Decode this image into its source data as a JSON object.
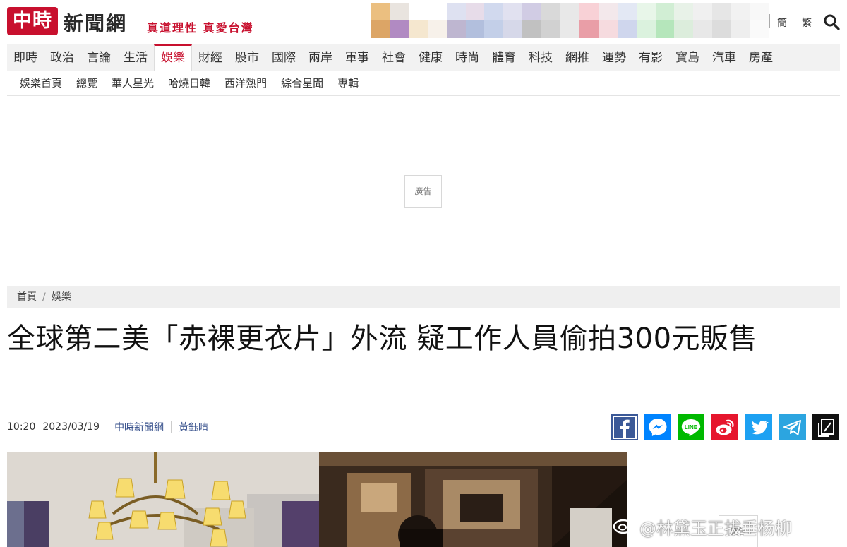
{
  "header": {
    "logo_mark": "中時",
    "logo_text": "新聞網",
    "slogan": "真道理性 真愛台灣",
    "lang_simplified": "簡",
    "lang_traditional": "繁"
  },
  "main_nav": [
    {
      "label": "即時"
    },
    {
      "label": "政治"
    },
    {
      "label": "言論"
    },
    {
      "label": "生活"
    },
    {
      "label": "娛樂",
      "active": true
    },
    {
      "label": "財經"
    },
    {
      "label": "股市"
    },
    {
      "label": "國際"
    },
    {
      "label": "兩岸"
    },
    {
      "label": "軍事"
    },
    {
      "label": "社會"
    },
    {
      "label": "健康"
    },
    {
      "label": "時尚"
    },
    {
      "label": "體育"
    },
    {
      "label": "科技"
    },
    {
      "label": "網推"
    },
    {
      "label": "運勢"
    },
    {
      "label": "有影"
    },
    {
      "label": "寶島"
    },
    {
      "label": "汽車"
    },
    {
      "label": "房產"
    }
  ],
  "sub_nav": [
    {
      "label": "娛樂首頁"
    },
    {
      "label": "總覽"
    },
    {
      "label": "華人星光"
    },
    {
      "label": "哈燒日韓"
    },
    {
      "label": "西洋熱門"
    },
    {
      "label": "綜合星聞"
    },
    {
      "label": "專輯"
    }
  ],
  "ads": {
    "top_label": "廣告",
    "side_label": "廣告"
  },
  "breadcrumb": {
    "home": "首頁",
    "separator": "/",
    "section": "娛樂"
  },
  "article": {
    "title": "全球第二美「赤裸更衣片」外流 疑工作人員偷拍300元販售",
    "time": "10:20",
    "date": "2023/03/19",
    "source": "中時新聞網",
    "author": "黃鈺晴"
  },
  "share": [
    {
      "name": "facebook",
      "color": "#3b5998"
    },
    {
      "name": "messenger",
      "color": "#0084ff"
    },
    {
      "name": "line",
      "color": "#00b900"
    },
    {
      "name": "weibo",
      "color": "#e6162d"
    },
    {
      "name": "twitter",
      "color": "#1da1f2"
    },
    {
      "name": "telegram",
      "color": "#2ca5e0"
    },
    {
      "name": "copy",
      "color": "#111111"
    }
  ],
  "watermark": {
    "text": "@林黛玉正拔垂杨柳"
  },
  "colors": {
    "brand": "#c8102e",
    "nav_bg": "#f2f2f2"
  }
}
